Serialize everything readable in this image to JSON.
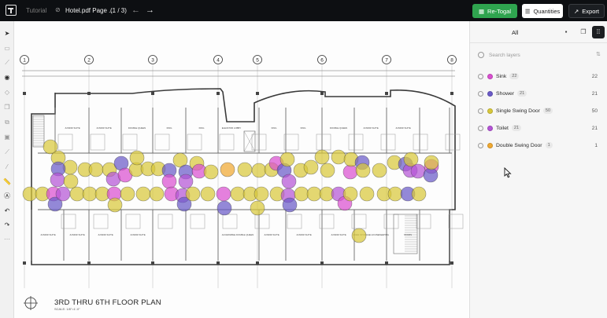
{
  "topbar": {
    "breadcrumb": "Tutorial",
    "file_name": "Hotel.pdf Page ...",
    "page_indicator": "(1 / 3)",
    "retogal_label": "Re-Togal",
    "quantities_label": "Quantities",
    "export_label": "Export"
  },
  "panel": {
    "tab_all": "All",
    "search_placeholder": "Search layers",
    "layers": [
      {
        "name": "Sink",
        "badge": "22",
        "count": "22",
        "color": "#d94fd0"
      },
      {
        "name": "Shower",
        "badge": "21",
        "count": "21",
        "color": "#6a5ac8"
      },
      {
        "name": "Single Swing Door",
        "badge": "50",
        "count": "50",
        "color": "#d8c83a"
      },
      {
        "name": "Toilet",
        "badge": "21",
        "count": "21",
        "color": "#b454d6"
      },
      {
        "name": "Double Swing Door",
        "badge": "1",
        "count": "1",
        "color": "#f0a830"
      }
    ]
  },
  "drawing": {
    "title": "3RD THRU 6TH FLOOR PLAN",
    "scale": "SCALE: 1/8\"=1'-0\"",
    "grid_labels": [
      "1",
      "2",
      "3",
      "4",
      "5",
      "6",
      "7",
      "8"
    ],
    "room_labels_top": [
      "JUNIOR SUITE",
      "JUNIOR SUITE",
      "DOUBLE QUEEN",
      "KING",
      "KING",
      "ELEVATOR LOBBY",
      "KING",
      "KING",
      "DOUBLE QUEEN",
      "JUNIOR SUITE",
      "JUNIOR SUITE"
    ],
    "room_labels_bottom": [
      "JUNIOR SUITE",
      "JUNIOR SUITE",
      "JUNIOR SUITE",
      "JUNIOR SUITE",
      "ACCESSIBLE DOUBLE QUEEN",
      "JUNIOR SUITE",
      "JUNIOR SUITE",
      "JUNIOR SUITE",
      "LINEN STORAGE HOUSEKEEPING",
      "STAIRS"
    ]
  },
  "colors": {
    "sink": "#d94fd0",
    "shower": "#6a5ac8",
    "door": "#d8c83a",
    "toilet": "#b454d6",
    "double_door": "#f0a830",
    "accent": "#2fa44f"
  }
}
